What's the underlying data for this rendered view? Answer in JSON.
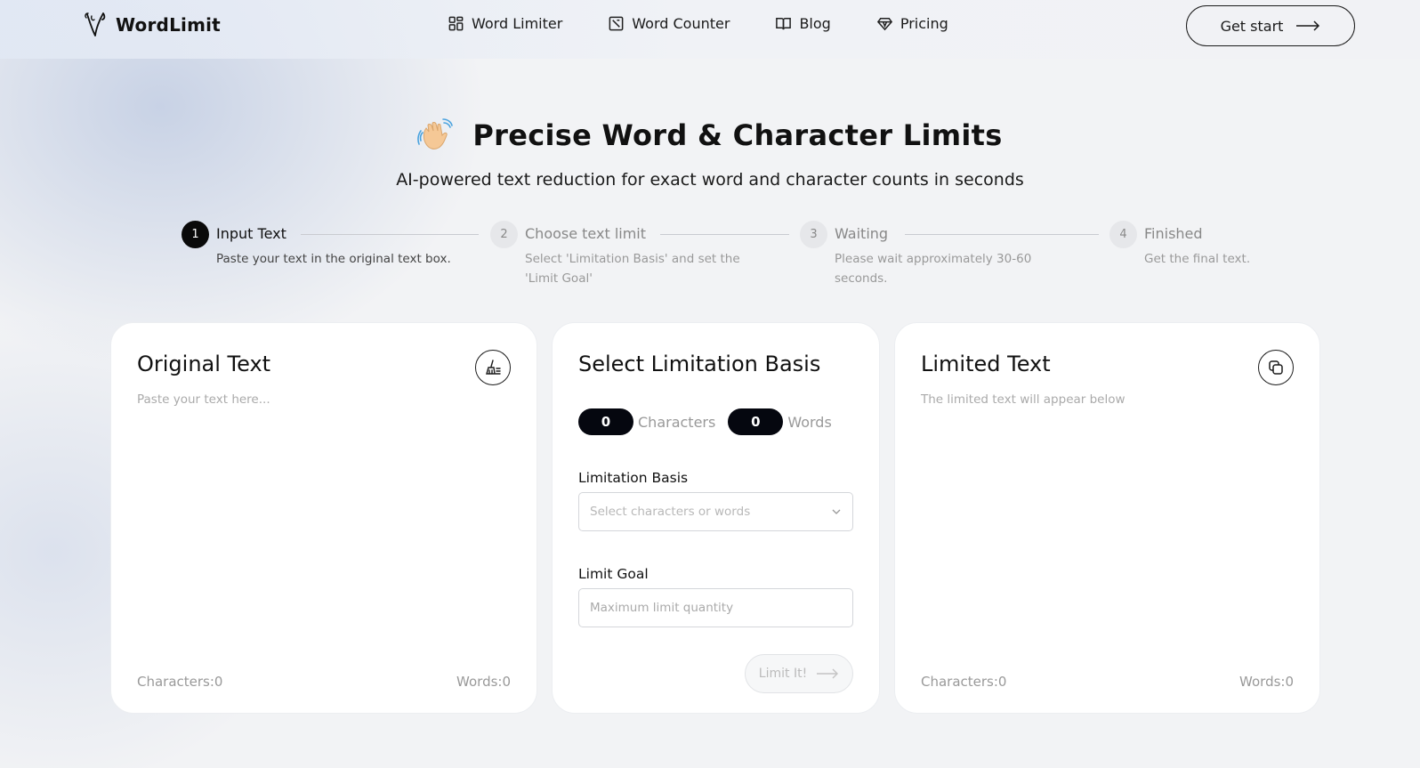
{
  "brand": {
    "name": "WordLimit"
  },
  "nav": {
    "links": [
      {
        "label": "Word Limiter",
        "icon": "grid-icon"
      },
      {
        "label": "Word Counter",
        "icon": "edit-square-icon"
      },
      {
        "label": "Blog",
        "icon": "book-icon"
      },
      {
        "label": "Pricing",
        "icon": "diamond-icon"
      }
    ],
    "cta_label": "Get start"
  },
  "hero": {
    "title": "Precise Word & Character Limits",
    "subtitle": "AI-powered text reduction for exact word and character counts in seconds"
  },
  "steps": [
    {
      "number": "1",
      "title": "Input Text",
      "desc": "Paste your text in the original text box.",
      "active": true
    },
    {
      "number": "2",
      "title": "Choose text limit",
      "desc": "Select 'Limitation Basis' and set the 'Limit Goal'",
      "active": false
    },
    {
      "number": "3",
      "title": "Waiting",
      "desc": "Please wait approximately 30-60 seconds.",
      "active": false
    },
    {
      "number": "4",
      "title": "Finished",
      "desc": "Get the final text.",
      "active": false
    }
  ],
  "original": {
    "title": "Original Text",
    "placeholder": "Paste your text here...",
    "chars_label": "Characters:0",
    "words_label": "Words:0"
  },
  "settings": {
    "title": "Select Limitation Basis",
    "char_count": "0",
    "char_label": "Characters",
    "word_count": "0",
    "word_label": "Words",
    "basis_label": "Limitation Basis",
    "basis_placeholder": "Select characters or words",
    "goal_label": "Limit Goal",
    "goal_placeholder": "Maximum limit quantity",
    "submit_label": "Limit It!"
  },
  "limited": {
    "title": "Limited Text",
    "hint": "The limited text will appear below",
    "chars_label": "Characters:0",
    "words_label": "Words:0"
  },
  "colors": {
    "accent": "#05070f",
    "muted": "#999999"
  }
}
